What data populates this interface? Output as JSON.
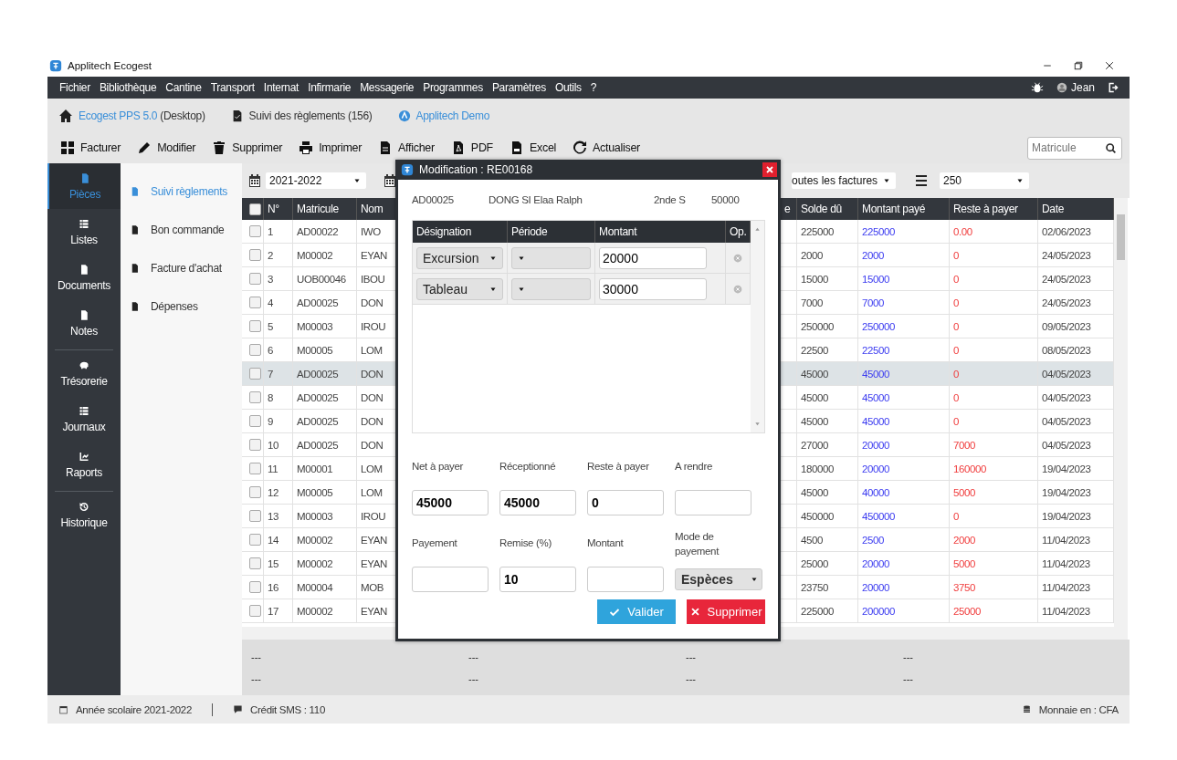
{
  "window": {
    "title": "Applitech Ecogest"
  },
  "menu": [
    "Fichier",
    "Bibliothèque",
    "Cantine",
    "Transport",
    "Internat",
    "Infirmarie",
    "Messagerie",
    "Programmes",
    "Paramètres",
    "Outils",
    "?"
  ],
  "user": {
    "name": "Jean"
  },
  "tabs": [
    {
      "kind": "app",
      "label": "Ecogest PPS 5.0",
      "suffix": "(Desktop)"
    },
    {
      "kind": "doc",
      "label": "Suivi des règlements (156)"
    },
    {
      "kind": "brand",
      "label": "Applitech Demo"
    }
  ],
  "toolbar": [
    {
      "kind": "grid",
      "label": "Facturer"
    },
    {
      "kind": "pencil",
      "label": "Modifier"
    },
    {
      "kind": "trash",
      "label": "Supprimer"
    },
    {
      "kind": "print",
      "label": "Imprimer"
    },
    {
      "kind": "file",
      "label": "Afficher"
    },
    {
      "kind": "pdf",
      "label": "PDF"
    },
    {
      "kind": "csv",
      "label": "Excel"
    },
    {
      "kind": "refresh",
      "label": "Actualiser"
    }
  ],
  "search": {
    "placeholder": "Matricule"
  },
  "sidebar": {
    "groups": [
      [
        {
          "label": "Pièces",
          "kind": "file",
          "selected": true
        },
        {
          "label": "Listes",
          "kind": "list",
          "selected": false
        },
        {
          "label": "Documents",
          "kind": "file",
          "selected": false
        },
        {
          "label": "Notes",
          "kind": "file",
          "selected": false
        }
      ],
      [
        {
          "label": "Trésorerie",
          "kind": "piggy",
          "selected": false
        },
        {
          "label": "Journaux",
          "kind": "list",
          "selected": false
        },
        {
          "label": "Raports",
          "kind": "chart",
          "selected": false
        }
      ],
      [
        {
          "label": "Historique",
          "kind": "history",
          "selected": false
        }
      ]
    ]
  },
  "subnav": [
    {
      "label": "Suivi règlements",
      "selected": true
    },
    {
      "label": "Bon commande",
      "selected": false
    },
    {
      "label": "Facture d'achat",
      "selected": false
    },
    {
      "label": "Dépenses",
      "selected": false
    }
  ],
  "filters": {
    "year": "2021-2022",
    "invoices": "outes les factures",
    "page_size": "250"
  },
  "table": {
    "select_all": {
      "checked": false
    },
    "columns": [
      "N°",
      "Matricule",
      "Nom",
      "e",
      "Solde dû",
      "Montant payé",
      "Reste à payer",
      "Date"
    ],
    "rows": [
      {
        "selected": false,
        "checked": false,
        "no": "1",
        "matricule": "AD00022",
        "nom": "IWO",
        "solde": "225000",
        "paye": "225000",
        "reste": "0.00",
        "date": "02/06/2023"
      },
      {
        "selected": false,
        "checked": false,
        "no": "2",
        "matricule": "M00002",
        "nom": "EYAN",
        "solde": "2000",
        "paye": "2000",
        "reste": "0",
        "date": "24/05/2023"
      },
      {
        "selected": false,
        "checked": false,
        "no": "3",
        "matricule": "UOB00046",
        "nom": "IBOU",
        "solde": "15000",
        "paye": "15000",
        "reste": "0",
        "date": "24/05/2023"
      },
      {
        "selected": false,
        "checked": false,
        "no": "4",
        "matricule": "AD00025",
        "nom": "DON",
        "solde": "7000",
        "paye": "7000",
        "reste": "0",
        "date": "24/05/2023"
      },
      {
        "selected": false,
        "checked": false,
        "no": "5",
        "matricule": "M00003",
        "nom": "IROU",
        "solde": "250000",
        "paye": "250000",
        "reste": "0",
        "date": "09/05/2023"
      },
      {
        "selected": false,
        "checked": false,
        "no": "6",
        "matricule": "M00005",
        "nom": "LOM",
        "solde": "22500",
        "paye": "22500",
        "reste": "0",
        "date": "08/05/2023"
      },
      {
        "selected": true,
        "checked": false,
        "no": "7",
        "matricule": "AD00025",
        "nom": "DON",
        "solde": "45000",
        "paye": "45000",
        "reste": "0",
        "date": "04/05/2023"
      },
      {
        "selected": false,
        "checked": false,
        "no": "8",
        "matricule": "AD00025",
        "nom": "DON",
        "solde": "45000",
        "paye": "45000",
        "reste": "0",
        "date": "04/05/2023"
      },
      {
        "selected": false,
        "checked": false,
        "no": "9",
        "matricule": "AD00025",
        "nom": "DON",
        "solde": "45000",
        "paye": "45000",
        "reste": "0",
        "date": "04/05/2023"
      },
      {
        "selected": false,
        "checked": false,
        "no": "10",
        "matricule": "AD00025",
        "nom": "DON",
        "solde": "27000",
        "paye": "20000",
        "reste": "7000",
        "date": "04/05/2023"
      },
      {
        "selected": false,
        "checked": false,
        "no": "11",
        "matricule": "M00001",
        "nom": "LOM",
        "solde": "180000",
        "paye": "20000",
        "reste": "160000",
        "date": "19/04/2023"
      },
      {
        "selected": false,
        "checked": false,
        "no": "12",
        "matricule": "M00005",
        "nom": "LOM",
        "solde": "45000",
        "paye": "40000",
        "reste": "5000",
        "date": "19/04/2023"
      },
      {
        "selected": false,
        "checked": false,
        "no": "13",
        "matricule": "M00003",
        "nom": "IROU",
        "solde": "450000",
        "paye": "450000",
        "reste": "0",
        "date": "19/04/2023"
      },
      {
        "selected": false,
        "checked": false,
        "no": "14",
        "matricule": "M00002",
        "nom": "EYAN",
        "solde": "4500",
        "paye": "2500",
        "reste": "2000",
        "date": "11/04/2023"
      },
      {
        "selected": false,
        "checked": false,
        "no": "15",
        "matricule": "M00002",
        "nom": "EYAN",
        "solde": "25000",
        "paye": "20000",
        "reste": "5000",
        "date": "11/04/2023"
      },
      {
        "selected": false,
        "checked": false,
        "no": "16",
        "matricule": "M00004",
        "nom": "MOB",
        "solde": "23750",
        "paye": "20000",
        "reste": "3750",
        "date": "11/04/2023"
      },
      {
        "selected": false,
        "checked": false,
        "no": "17",
        "matricule": "M00002",
        "nom": "EYAN",
        "solde": "225000",
        "paye": "200000",
        "reste": "25000",
        "date": "11/04/2023"
      }
    ]
  },
  "summary": [
    [
      "---",
      "---",
      "---",
      "---"
    ],
    [
      "---",
      "---",
      "---",
      "---"
    ]
  ],
  "status_bar": {
    "year": "Année scolaire 2021-2022",
    "sms": "Crédit SMS : 110",
    "currency": "Monnaie en : CFA"
  },
  "dialog": {
    "title": "Modification : RE00168",
    "student": {
      "matricule": "AD00025",
      "name": "DONG SI Elaa Ralph",
      "class": "2nde S",
      "amount": "50000"
    },
    "columns": [
      "Désignation",
      "Période",
      "Montant",
      "Op."
    ],
    "lines": [
      {
        "designation": "Excursion",
        "montant": "20000"
      },
      {
        "designation": "Tableau",
        "montant": "30000"
      }
    ],
    "fields": [
      {
        "kind": "input",
        "label": "Net à payer",
        "value": "45000"
      },
      {
        "kind": "input",
        "label": "Réceptionné",
        "value": "45000"
      },
      {
        "kind": "input",
        "label": "Reste à payer",
        "value": "0"
      },
      {
        "kind": "input",
        "label": "A rendre"
      },
      {
        "kind": "input",
        "label": "Payement"
      },
      {
        "kind": "input",
        "label": "Remise (%)",
        "value": "10"
      },
      {
        "kind": "input",
        "label": "Montant"
      },
      {
        "kind": "select",
        "label": "Mode de payement",
        "value": "Espèces"
      }
    ],
    "buttons": [
      {
        "kind": "ok",
        "label": "Valider"
      },
      {
        "kind": "danger",
        "label": "Supprimer"
      }
    ]
  }
}
